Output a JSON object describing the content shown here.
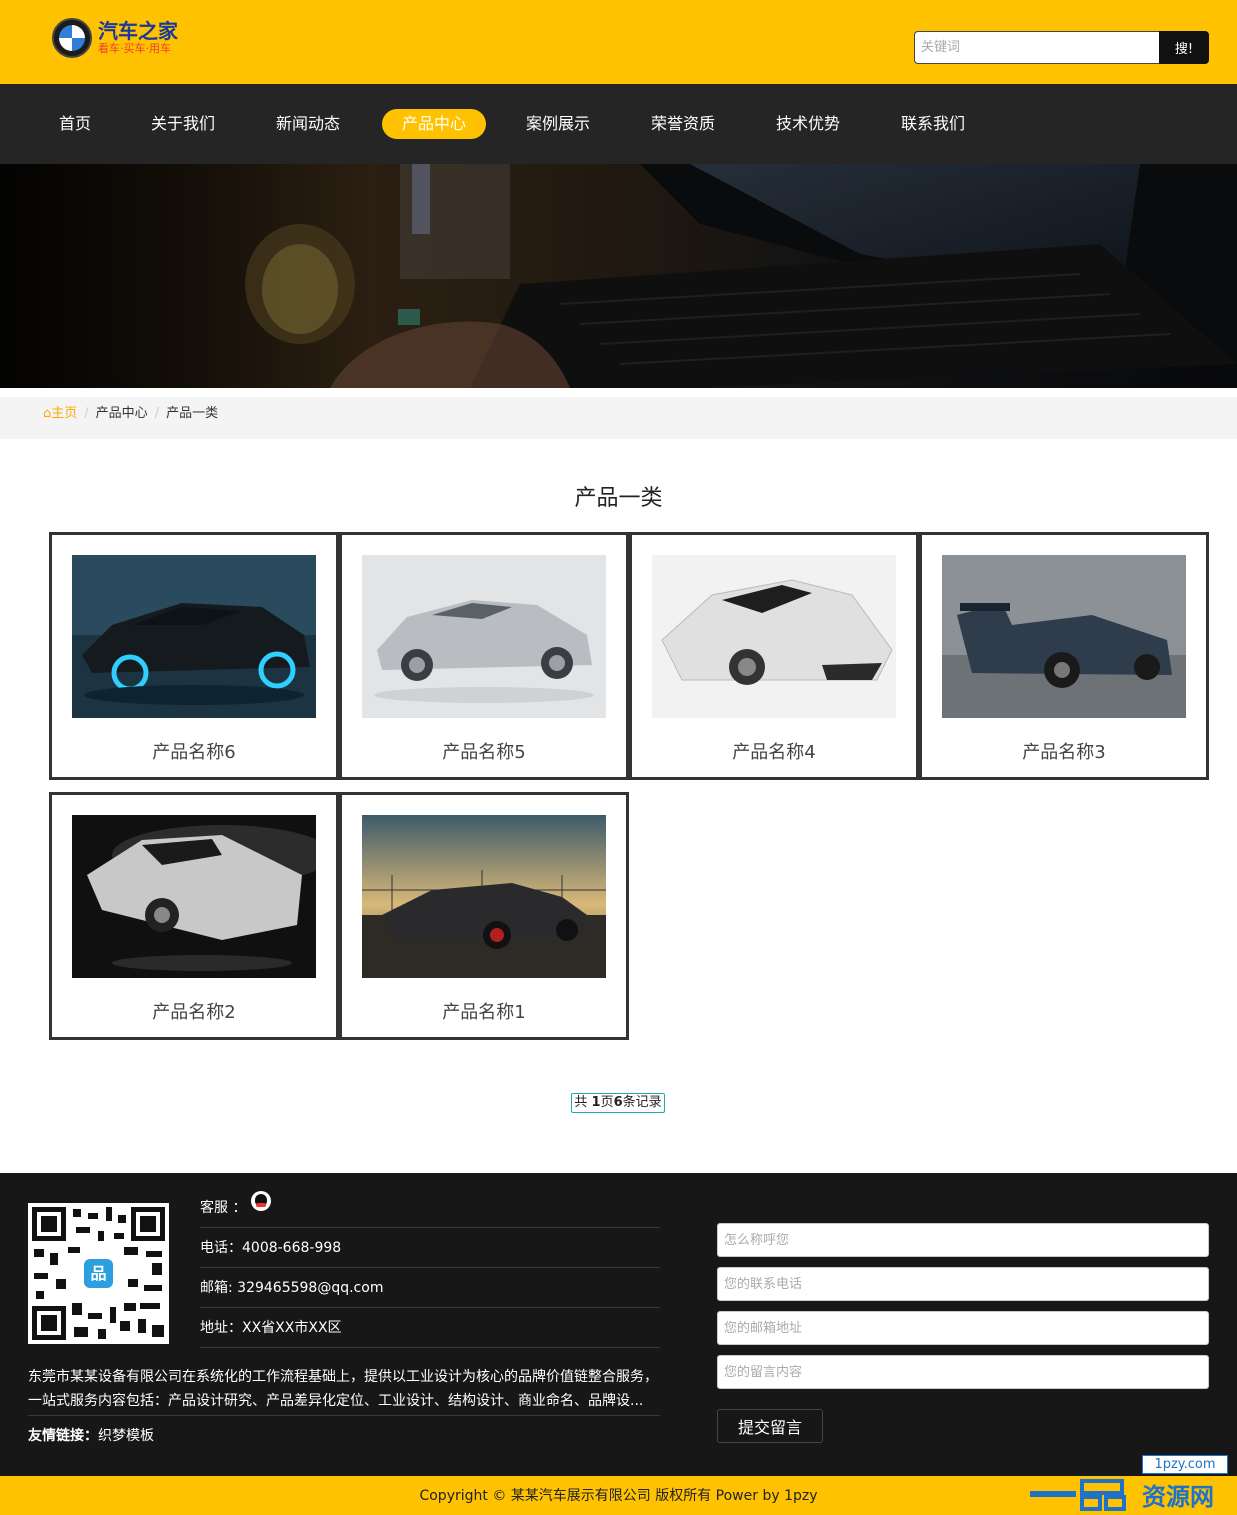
{
  "header": {
    "logo_title": "汽车之家",
    "logo_sub": "看车·买车·用车",
    "search_placeholder": "关键词",
    "search_button": "搜!"
  },
  "nav": {
    "items": [
      "首页",
      "关于我们",
      "新闻动态",
      "产品中心",
      "案例展示",
      "荣誉资质",
      "技术优势",
      "联系我们"
    ],
    "active": "产品中心"
  },
  "breadcrumb": {
    "home": "主页",
    "items": [
      "产品中心",
      "产品一类"
    ]
  },
  "section_title": "产品一类",
  "products": [
    {
      "name": "产品名称6"
    },
    {
      "name": "产品名称5"
    },
    {
      "name": "产品名称4"
    },
    {
      "name": "产品名称3"
    },
    {
      "name": "产品名称2"
    },
    {
      "name": "产品名称1"
    }
  ],
  "pager": {
    "prefix": "共",
    "pages": "1",
    "mid": "页",
    "records": "6",
    "suffix": "条记录"
  },
  "footer": {
    "service_label": "客服 ：",
    "phone": "电话：4008-668-998",
    "email": "邮箱: 329465598@qq.com",
    "address": "地址：XX省XX市XX区",
    "about": "东莞市某某设备有限公司在系统化的工作流程基础上，提供以工业设计为核心的品牌价值链整合服务，一站式服务内容包括：产品设计研究、产品差异化定位、工业设计、结构设计、商业命名、品牌设...",
    "links_label": "友情链接：",
    "links": [
      "织梦模板"
    ],
    "form": {
      "name_placeholder": "怎么称呼您",
      "phone_placeholder": "您的联系电话",
      "email_placeholder": "您的邮箱地址",
      "message_placeholder": "您的留言内容",
      "submit": "提交留言"
    }
  },
  "copyright": "Copyright © 某某汽车展示有限公司 版权所有 Power by 1pzy",
  "watermark": {
    "url": "1pzy.com",
    "text": "资源网"
  },
  "colors": {
    "accent": "#ffc200",
    "nav_bg": "#252525",
    "footer_bg": "#171717"
  }
}
